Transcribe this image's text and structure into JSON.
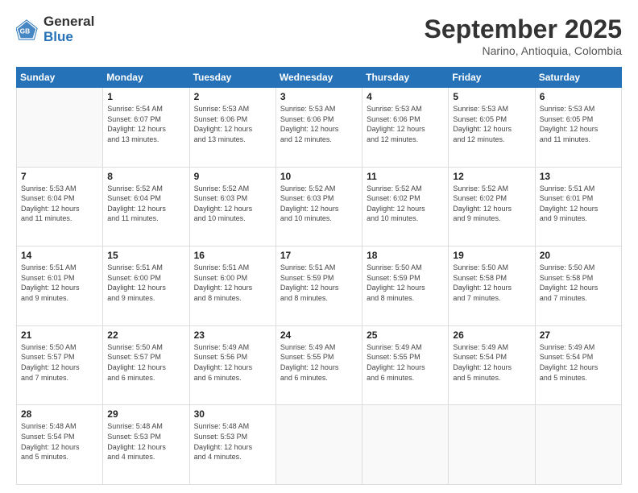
{
  "logo": {
    "general": "General",
    "blue": "Blue"
  },
  "header": {
    "month": "September 2025",
    "location": "Narino, Antioquia, Colombia"
  },
  "weekdays": [
    "Sunday",
    "Monday",
    "Tuesday",
    "Wednesday",
    "Thursday",
    "Friday",
    "Saturday"
  ],
  "weeks": [
    [
      {
        "day": "",
        "info": ""
      },
      {
        "day": "1",
        "info": "Sunrise: 5:54 AM\nSunset: 6:07 PM\nDaylight: 12 hours\nand 13 minutes."
      },
      {
        "day": "2",
        "info": "Sunrise: 5:53 AM\nSunset: 6:06 PM\nDaylight: 12 hours\nand 13 minutes."
      },
      {
        "day": "3",
        "info": "Sunrise: 5:53 AM\nSunset: 6:06 PM\nDaylight: 12 hours\nand 12 minutes."
      },
      {
        "day": "4",
        "info": "Sunrise: 5:53 AM\nSunset: 6:06 PM\nDaylight: 12 hours\nand 12 minutes."
      },
      {
        "day": "5",
        "info": "Sunrise: 5:53 AM\nSunset: 6:05 PM\nDaylight: 12 hours\nand 12 minutes."
      },
      {
        "day": "6",
        "info": "Sunrise: 5:53 AM\nSunset: 6:05 PM\nDaylight: 12 hours\nand 11 minutes."
      }
    ],
    [
      {
        "day": "7",
        "info": "Sunrise: 5:53 AM\nSunset: 6:04 PM\nDaylight: 12 hours\nand 11 minutes."
      },
      {
        "day": "8",
        "info": "Sunrise: 5:52 AM\nSunset: 6:04 PM\nDaylight: 12 hours\nand 11 minutes."
      },
      {
        "day": "9",
        "info": "Sunrise: 5:52 AM\nSunset: 6:03 PM\nDaylight: 12 hours\nand 10 minutes."
      },
      {
        "day": "10",
        "info": "Sunrise: 5:52 AM\nSunset: 6:03 PM\nDaylight: 12 hours\nand 10 minutes."
      },
      {
        "day": "11",
        "info": "Sunrise: 5:52 AM\nSunset: 6:02 PM\nDaylight: 12 hours\nand 10 minutes."
      },
      {
        "day": "12",
        "info": "Sunrise: 5:52 AM\nSunset: 6:02 PM\nDaylight: 12 hours\nand 9 minutes."
      },
      {
        "day": "13",
        "info": "Sunrise: 5:51 AM\nSunset: 6:01 PM\nDaylight: 12 hours\nand 9 minutes."
      }
    ],
    [
      {
        "day": "14",
        "info": "Sunrise: 5:51 AM\nSunset: 6:01 PM\nDaylight: 12 hours\nand 9 minutes."
      },
      {
        "day": "15",
        "info": "Sunrise: 5:51 AM\nSunset: 6:00 PM\nDaylight: 12 hours\nand 9 minutes."
      },
      {
        "day": "16",
        "info": "Sunrise: 5:51 AM\nSunset: 6:00 PM\nDaylight: 12 hours\nand 8 minutes."
      },
      {
        "day": "17",
        "info": "Sunrise: 5:51 AM\nSunset: 5:59 PM\nDaylight: 12 hours\nand 8 minutes."
      },
      {
        "day": "18",
        "info": "Sunrise: 5:50 AM\nSunset: 5:59 PM\nDaylight: 12 hours\nand 8 minutes."
      },
      {
        "day": "19",
        "info": "Sunrise: 5:50 AM\nSunset: 5:58 PM\nDaylight: 12 hours\nand 7 minutes."
      },
      {
        "day": "20",
        "info": "Sunrise: 5:50 AM\nSunset: 5:58 PM\nDaylight: 12 hours\nand 7 minutes."
      }
    ],
    [
      {
        "day": "21",
        "info": "Sunrise: 5:50 AM\nSunset: 5:57 PM\nDaylight: 12 hours\nand 7 minutes."
      },
      {
        "day": "22",
        "info": "Sunrise: 5:50 AM\nSunset: 5:57 PM\nDaylight: 12 hours\nand 6 minutes."
      },
      {
        "day": "23",
        "info": "Sunrise: 5:49 AM\nSunset: 5:56 PM\nDaylight: 12 hours\nand 6 minutes."
      },
      {
        "day": "24",
        "info": "Sunrise: 5:49 AM\nSunset: 5:55 PM\nDaylight: 12 hours\nand 6 minutes."
      },
      {
        "day": "25",
        "info": "Sunrise: 5:49 AM\nSunset: 5:55 PM\nDaylight: 12 hours\nand 6 minutes."
      },
      {
        "day": "26",
        "info": "Sunrise: 5:49 AM\nSunset: 5:54 PM\nDaylight: 12 hours\nand 5 minutes."
      },
      {
        "day": "27",
        "info": "Sunrise: 5:49 AM\nSunset: 5:54 PM\nDaylight: 12 hours\nand 5 minutes."
      }
    ],
    [
      {
        "day": "28",
        "info": "Sunrise: 5:48 AM\nSunset: 5:54 PM\nDaylight: 12 hours\nand 5 minutes."
      },
      {
        "day": "29",
        "info": "Sunrise: 5:48 AM\nSunset: 5:53 PM\nDaylight: 12 hours\nand 4 minutes."
      },
      {
        "day": "30",
        "info": "Sunrise: 5:48 AM\nSunset: 5:53 PM\nDaylight: 12 hours\nand 4 minutes."
      },
      {
        "day": "",
        "info": ""
      },
      {
        "day": "",
        "info": ""
      },
      {
        "day": "",
        "info": ""
      },
      {
        "day": "",
        "info": ""
      }
    ]
  ]
}
